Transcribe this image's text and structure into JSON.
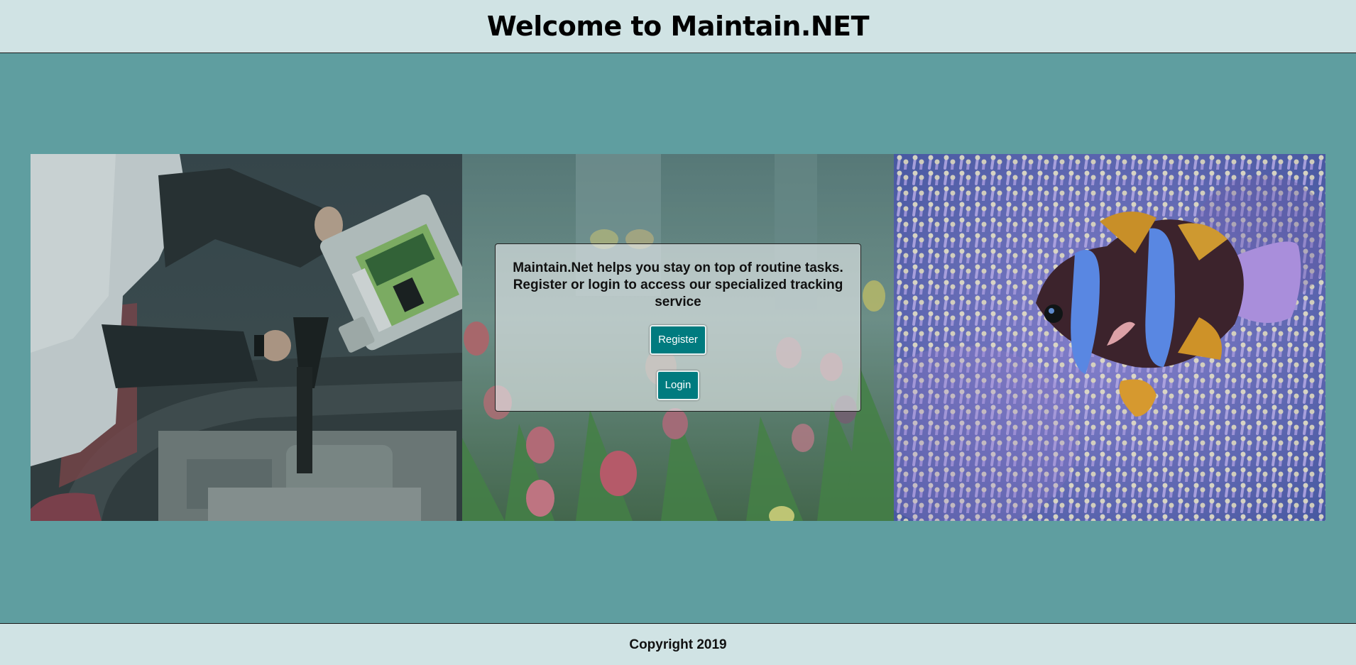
{
  "header": {
    "title": "Welcome to Maintain.NET"
  },
  "gallery": {
    "images": [
      {
        "name": "car-oil-change-photo"
      },
      {
        "name": "tulip-garden-photo"
      },
      {
        "name": "clownfish-anemone-photo"
      }
    ]
  },
  "intro": {
    "text": "Maintain.Net helps you stay on top of routine tasks. Register or login to access our specialized tracking service",
    "register_label": "Register",
    "login_label": "Login"
  },
  "footer": {
    "copyright": "Copyright 2019"
  },
  "colors": {
    "page_background": "#5f9ea0",
    "header_background": "#d0e3e4",
    "button_background": "#007b7f"
  }
}
